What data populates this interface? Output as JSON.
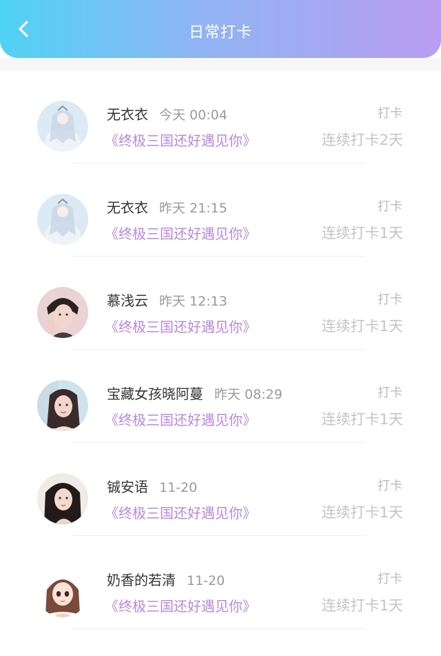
{
  "header": {
    "title": "日常打卡",
    "back_icon": "chevron-left-icon",
    "gradient": [
      "#4fd3f3",
      "#8fb4f3",
      "#b99df0"
    ]
  },
  "checkins": [
    {
      "name": "无衣衣",
      "time": "今天 00:04",
      "game": "《终极三国还好遇见你》",
      "type": "打卡",
      "streak": "连续打卡2天"
    },
    {
      "name": "无衣衣",
      "time": "昨天 21:15",
      "game": "《终极三国还好遇见你》",
      "type": "打卡",
      "streak": "连续打卡1天"
    },
    {
      "name": "慕浅云",
      "time": "昨天 12:13",
      "game": "《终极三国还好遇见你》",
      "type": "打卡",
      "streak": "连续打卡1天"
    },
    {
      "name": "宝藏女孩晓阿蔓",
      "time": "昨天 08:29",
      "game": "《终极三国还好遇见你》",
      "type": "打卡",
      "streak": "连续打卡1天"
    },
    {
      "name": "铖安语",
      "time": "11-20",
      "game": "《终极三国还好遇见你》",
      "type": "打卡",
      "streak": "连续打卡1天"
    },
    {
      "name": "奶香的若清",
      "time": "11-20",
      "game": "《终极三国还好遇见你》",
      "type": "打卡",
      "streak": "连续打卡1天"
    }
  ],
  "colors": {
    "game_link": "#b888d6",
    "name": "#333333",
    "muted": "#999999"
  }
}
